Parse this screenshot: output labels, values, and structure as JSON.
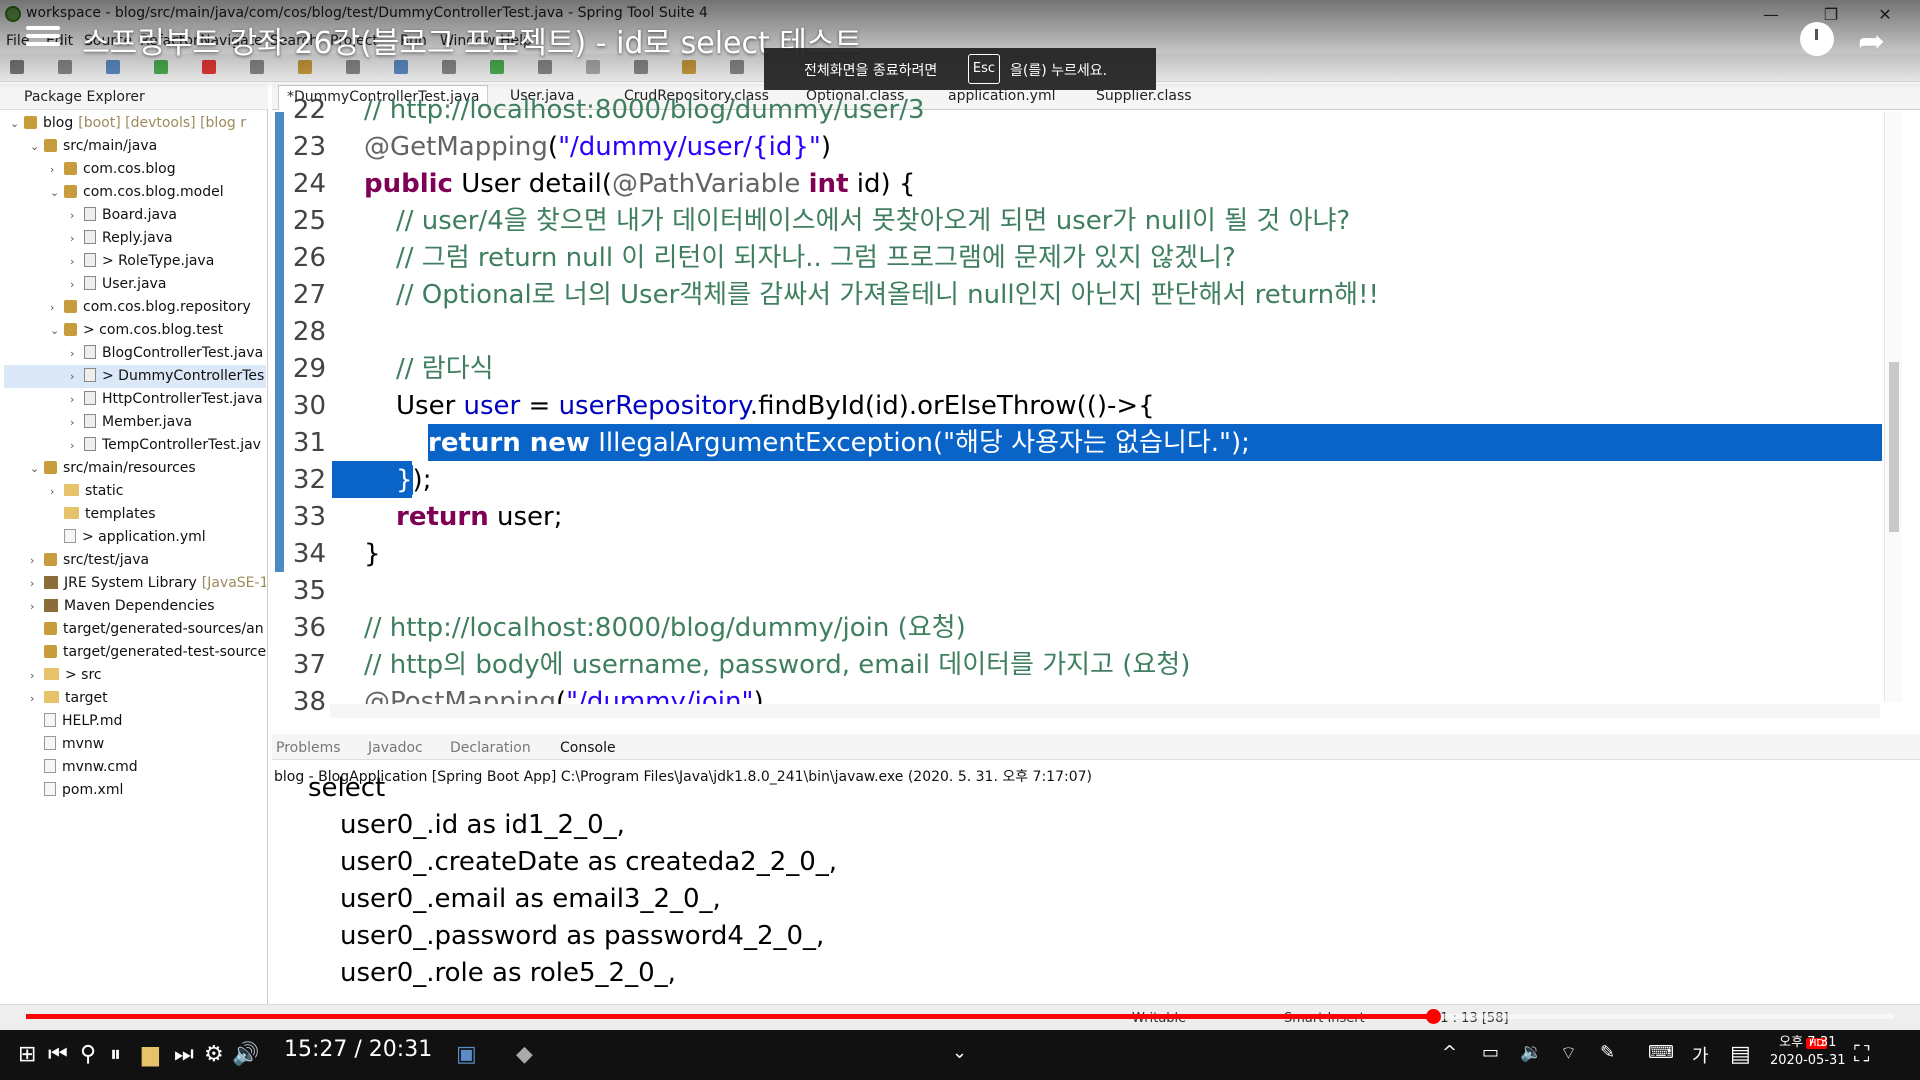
{
  "window": {
    "title": "workspace - blog/src/main/java/com/cos/blog/test/DummyControllerTest.java - Spring Tool Suite 4"
  },
  "video": {
    "title": "스프링부트 강좌 26강(블로그 프로젝트) - id로 select 테스트",
    "time": "15:27 / 20:31",
    "progress_fraction": 0.753,
    "fullscreen_tip_prefix": "전체화면을 종료하려면",
    "fullscreen_tip_key": "Esc",
    "fullscreen_tip_suffix": "을(를) 누르세요."
  },
  "menubar": [
    "File",
    "Edit",
    "Source",
    "Refactor",
    "Navigate",
    "Search",
    "Project",
    "Run",
    "Window",
    "Help"
  ],
  "explorer": {
    "title": "Package Explorer",
    "rows": [
      {
        "label": "blog",
        "extra": "[boot] [devtools] [blog r",
        "indent": 0,
        "icon": "pkg",
        "arrow": "⌄"
      },
      {
        "label": "src/main/java",
        "extra": "",
        "indent": 1,
        "icon": "pkg",
        "arrow": "⌄"
      },
      {
        "label": "com.cos.blog",
        "extra": "",
        "indent": 2,
        "icon": "pkg",
        "arrow": "›"
      },
      {
        "label": "com.cos.blog.model",
        "extra": "",
        "indent": 2,
        "icon": "pkg",
        "arrow": "⌄"
      },
      {
        "label": "Board.java",
        "extra": "",
        "indent": 3,
        "icon": "java",
        "arrow": "›"
      },
      {
        "label": "Reply.java",
        "extra": "",
        "indent": 3,
        "icon": "java",
        "arrow": "›"
      },
      {
        "label": "> RoleType.java",
        "extra": "",
        "indent": 3,
        "icon": "java",
        "arrow": "›"
      },
      {
        "label": "User.java",
        "extra": "",
        "indent": 3,
        "icon": "java",
        "arrow": "›"
      },
      {
        "label": "com.cos.blog.repository",
        "extra": "",
        "indent": 2,
        "icon": "pkg",
        "arrow": "›"
      },
      {
        "label": "> com.cos.blog.test",
        "extra": "",
        "indent": 2,
        "icon": "pkg",
        "arrow": "⌄"
      },
      {
        "label": "BlogControllerTest.java",
        "extra": "",
        "indent": 3,
        "icon": "java",
        "arrow": "›"
      },
      {
        "label": "> DummyControllerTes",
        "extra": "",
        "indent": 3,
        "icon": "java",
        "arrow": "›",
        "selected": true
      },
      {
        "label": "HttpControllerTest.java",
        "extra": "",
        "indent": 3,
        "icon": "java",
        "arrow": "›"
      },
      {
        "label": "Member.java",
        "extra": "",
        "indent": 3,
        "icon": "java",
        "arrow": "›"
      },
      {
        "label": "TempControllerTest.jav",
        "extra": "",
        "indent": 3,
        "icon": "java",
        "arrow": "›"
      },
      {
        "label": "src/main/resources",
        "extra": "",
        "indent": 1,
        "icon": "pkg",
        "arrow": "⌄"
      },
      {
        "label": "static",
        "extra": "",
        "indent": 2,
        "icon": "fold",
        "arrow": "›"
      },
      {
        "label": "templates",
        "extra": "",
        "indent": 2,
        "icon": "fold",
        "arrow": ""
      },
      {
        "label": "> application.yml",
        "extra": "",
        "indent": 2,
        "icon": "file",
        "arrow": ""
      },
      {
        "label": "src/test/java",
        "extra": "",
        "indent": 1,
        "icon": "pkg",
        "arrow": "›"
      },
      {
        "label": "JRE System Library",
        "extra": "[JavaSE-1.",
        "indent": 1,
        "icon": "lib",
        "arrow": "›"
      },
      {
        "label": "Maven Dependencies",
        "extra": "",
        "indent": 1,
        "icon": "lib",
        "arrow": "›"
      },
      {
        "label": "target/generated-sources/an",
        "extra": "",
        "indent": 1,
        "icon": "pkg",
        "arrow": ""
      },
      {
        "label": "target/generated-test-source",
        "extra": "",
        "indent": 1,
        "icon": "pkg",
        "arrow": ""
      },
      {
        "label": "> src",
        "extra": "",
        "indent": 1,
        "icon": "fold",
        "arrow": "›"
      },
      {
        "label": "target",
        "extra": "",
        "indent": 1,
        "icon": "fold",
        "arrow": "›"
      },
      {
        "label": "HELP.md",
        "extra": "",
        "indent": 1,
        "icon": "file",
        "arrow": ""
      },
      {
        "label": "mvnw",
        "extra": "",
        "indent": 1,
        "icon": "file",
        "arrow": ""
      },
      {
        "label": "mvnw.cmd",
        "extra": "",
        "indent": 1,
        "icon": "file",
        "arrow": ""
      },
      {
        "label": "pom.xml",
        "extra": "",
        "indent": 1,
        "icon": "file",
        "arrow": ""
      }
    ]
  },
  "editor_tabs": [
    "*DummyControllerTest.java",
    "User.java",
    "CrudRepository.class",
    "Optional.class",
    "application.yml",
    "Supplier.class"
  ],
  "code": [
    {
      "n": "22",
      "html": "<span class=\"cm\">// http://localhost:8000/blog/dummy/user/3</span>",
      "indent": 0
    },
    {
      "n": "23",
      "html": "<span class=\"an\">@GetMapping</span>(<span class=\"st\">\"/dummy/user/{id}\"</span>)",
      "indent": 0
    },
    {
      "n": "24",
      "html": "<span class=\"kw\">public</span> User detail(<span class=\"an\">@PathVariable</span> <span class=\"kw\">int</span> id) {",
      "indent": 0
    },
    {
      "n": "25",
      "html": "<span class=\"cm\">// user/4을 찾으면 내가 데이터베이스에서 못찾아오게 되면 user가 null이 될 것 아냐?</span>",
      "indent": 1
    },
    {
      "n": "26",
      "html": "<span class=\"cm\">// 그럼 return null 이 리턴이 되자나.. 그럼 프로그램에 문제가 있지 않겠니?</span>",
      "indent": 1
    },
    {
      "n": "27",
      "html": "<span class=\"cm\">// Optional로 너의 User객체를 감싸서 가져올테니 null인지 아닌지 판단해서 return해!!</span>",
      "indent": 1
    },
    {
      "n": "28",
      "html": "",
      "indent": 1
    },
    {
      "n": "29",
      "html": "<span class=\"cm\">// 람다식</span>",
      "indent": 1
    },
    {
      "n": "30",
      "html": "User <span class=\"fld\">user</span> = <span class=\"fld\">userRepository</span>.findById(id).orElseThrow(()->{",
      "indent": 1
    },
    {
      "n": "31",
      "html": "<span class=\"sel\"><b>return new</b> IllegalArgumentException(\"해당 사용자는 없습니다.\");</span>",
      "indent": 2
    },
    {
      "n": "32",
      "html": "<span class=\"sel\">}</span>);",
      "indent": 1
    },
    {
      "n": "33",
      "html": "<span class=\"kw\">return</span> user;",
      "indent": 1
    },
    {
      "n": "34",
      "html": "}",
      "indent": 0
    },
    {
      "n": "35",
      "html": "",
      "indent": 0
    },
    {
      "n": "36",
      "html": "<span class=\"cm\">// http://localhost:8000/blog/dummy/join (요청)</span>",
      "indent": 0
    },
    {
      "n": "37",
      "html": "<span class=\"cm\">// http의 body에 username, password, email 데이터를 가지고 (요청)</span>",
      "indent": 0
    },
    {
      "n": "38",
      "html": "<span class=\"an\">@PostMapping</span>(<span class=\"st\">\"/dummy/join\"</span>)",
      "indent": 0
    }
  ],
  "console_tabs": [
    "Problems",
    "Javadoc",
    "Declaration",
    "Console"
  ],
  "console": {
    "info": "blog - BlogApplication [Spring Boot App] C:\\Program Files\\Java\\jdk1.8.0_241\\bin\\javaw.exe  (2020. 5. 31. 오후 7:17:07)",
    "lines": [
      "select",
      "user0_.id as id1_2_0_,",
      "user0_.createDate as createda2_2_0_,",
      "user0_.email as email3_2_0_,",
      "user0_.password as password4_2_0_,",
      "user0_.role as role5_2_0_,"
    ]
  },
  "status": {
    "writable": "Writable",
    "insert": "Smart Insert",
    "position": "31 : 13 [58]"
  },
  "taskbar": {
    "time": "오후 7:31",
    "date": "2020-05-31",
    "badge": "HD",
    "ime": "가"
  }
}
